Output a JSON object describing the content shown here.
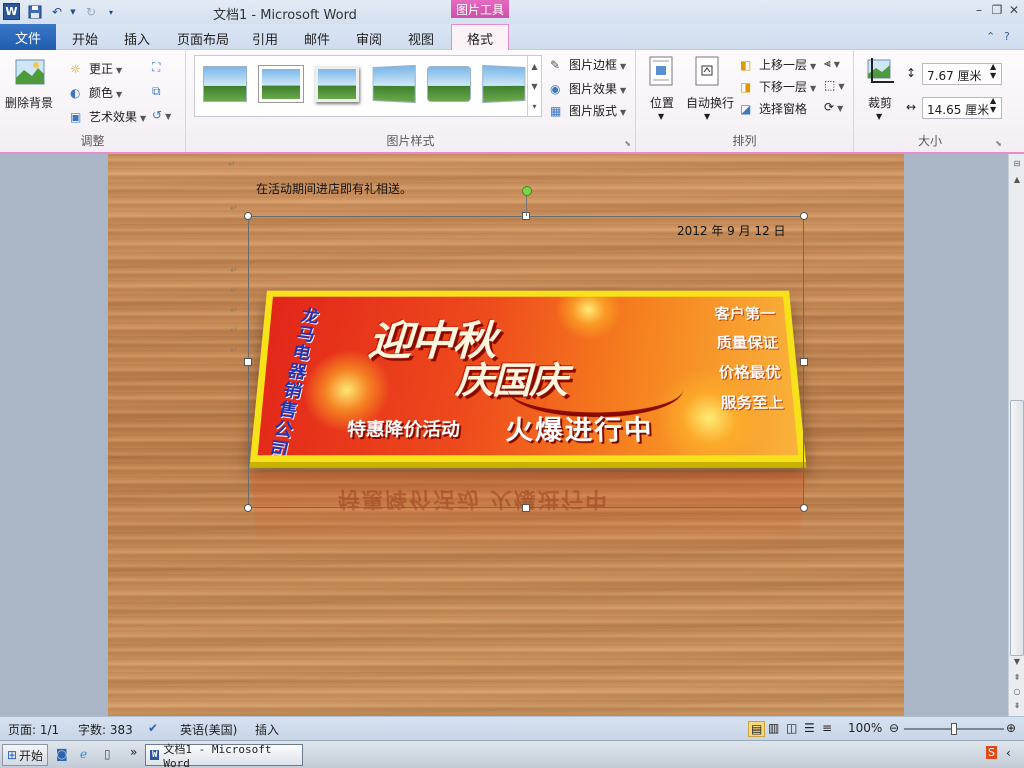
{
  "titlebar": {
    "doc_title": "文档1  -  Microsoft Word",
    "picture_tools": "图片工具",
    "word_logo": "W"
  },
  "tabs": {
    "file": "文件",
    "items": [
      "开始",
      "插入",
      "页面布局",
      "引用",
      "邮件",
      "审阅",
      "视图"
    ],
    "format": "格式"
  },
  "ribbon": {
    "adjust": {
      "remove_bg": "删除背景",
      "corrections": "更正",
      "color": "颜色",
      "artistic": "艺术效果",
      "label": "调整"
    },
    "styles": {
      "border": "图片边框",
      "effects": "图片效果",
      "layout": "图片版式",
      "label": "图片样式"
    },
    "arrange": {
      "position": "位置",
      "wrap": "自动换行",
      "bring_forward": "上移一层",
      "send_backward": "下移一层",
      "selection_pane": "选择窗格",
      "label": "排列"
    },
    "size": {
      "crop": "裁剪",
      "height": "7.67 厘米",
      "width": "14.65 厘米",
      "label": "大小"
    }
  },
  "document": {
    "line1": "在活动期间进店即有礼相送。",
    "date": "2012 年 9 月 12 日",
    "banner": {
      "company": "龙马电器销售公司",
      "headline1": "迎中秋",
      "headline2": "庆国庆",
      "promo_left": "特惠降价活动",
      "promo_right": "火爆进行中",
      "slogans": [
        "客户第一",
        "质量保证",
        "价格最优",
        "服务至上"
      ]
    }
  },
  "statusbar": {
    "page": "页面: 1/1",
    "words": "字数: 383",
    "language": "英语(美国)",
    "mode": "插入",
    "zoom": "100%",
    "zoom_level": 0.5
  },
  "taskbar": {
    "start": "开始",
    "word_task": "文档1 - Microsoft Word"
  },
  "colors": {
    "accent_pink": "#e58ccd",
    "file_tab": "#2b63b0",
    "banner_red": "#e2261a",
    "banner_border": "#f7e21a"
  }
}
